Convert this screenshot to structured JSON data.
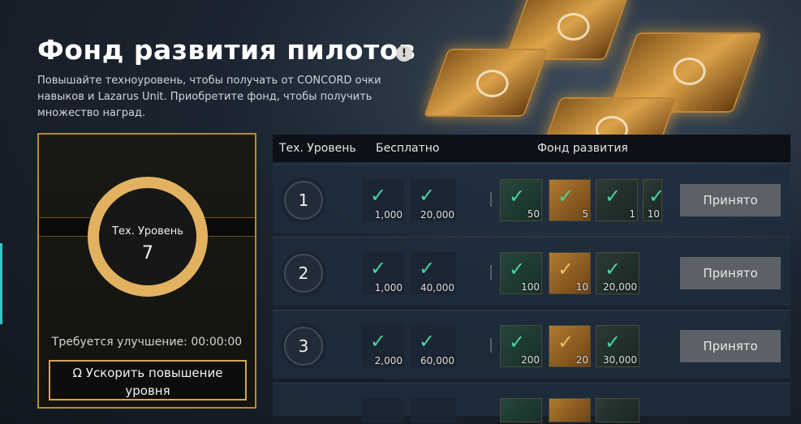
{
  "header": {
    "title": "Фонд развития пилотов",
    "info_icon": "!",
    "subtitle": "Повышайте техноуровень, чтобы получать от CONCORD очки навыков и Lazarus Unit. Приобретите фонд, чтобы получить множество наград."
  },
  "left_panel": {
    "ring_label": "Тех. Уровень",
    "level": "7",
    "upgrade_required": "Требуется улучшение: 00:00:00",
    "speed_button": "Ускорить повышение уровня",
    "speed_button_icon": "Ω"
  },
  "table": {
    "columns": [
      "Тех. Уровень",
      "Бесплатно",
      "Фонд развития"
    ],
    "rows": [
      {
        "level": "1",
        "free": [
          {
            "icon": "skill-injector-icon",
            "count": "1,000"
          },
          {
            "icon": "lazarus-unit-icon",
            "count": "20,000"
          }
        ],
        "fund": [
          {
            "icon": "skill-crate-icon",
            "style": "green",
            "count": "50"
          },
          {
            "icon": "gold-crate-icon",
            "style": "gold",
            "count": "5"
          },
          {
            "icon": "skill-injector-icon",
            "style": "teal",
            "count": "1"
          },
          {
            "icon": "skill-injector-icon",
            "style": "teal",
            "count": "10"
          }
        ],
        "button": "Принято"
      },
      {
        "level": "2",
        "free": [
          {
            "icon": "skill-injector-icon",
            "count": "1,000"
          },
          {
            "icon": "lazarus-unit-icon",
            "count": "40,000"
          }
        ],
        "fund": [
          {
            "icon": "skill-crate-icon",
            "style": "green",
            "count": "100"
          },
          {
            "icon": "gold-crate-icon",
            "style": "gold",
            "count": "10"
          },
          {
            "icon": "lazarus-unit-icon",
            "style": "teal",
            "count": "20,000"
          }
        ],
        "button": "Принято"
      },
      {
        "level": "3",
        "free": [
          {
            "icon": "skill-injector-icon",
            "count": "2,000"
          },
          {
            "icon": "lazarus-unit-icon",
            "count": "60,000"
          }
        ],
        "fund": [
          {
            "icon": "skill-crate-icon",
            "style": "green",
            "count": "200"
          },
          {
            "icon": "gold-crate-icon",
            "style": "gold",
            "count": "20"
          },
          {
            "icon": "lazarus-unit-icon",
            "style": "teal",
            "count": "30,000"
          }
        ],
        "button": "Принято"
      }
    ]
  },
  "colors": {
    "gold_accent": "#e2b261",
    "panel_border": "#b48a3c",
    "accept_button": "#5c6167",
    "icon_green": "#44d6a0"
  }
}
